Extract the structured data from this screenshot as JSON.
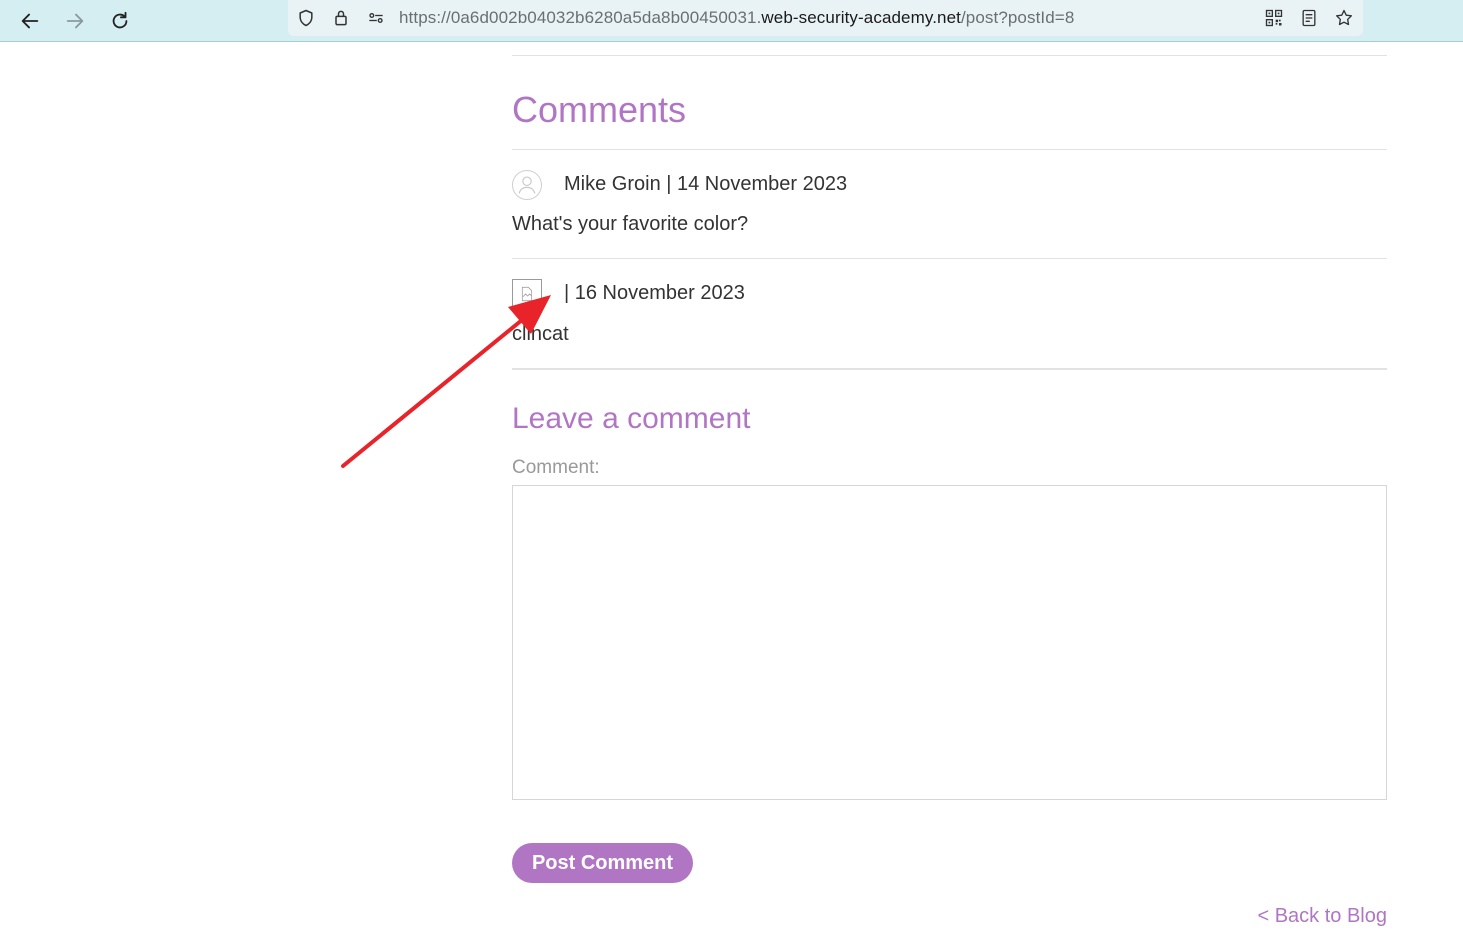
{
  "browser": {
    "url_prefix": "https://0a6d002b04032b6280a5da8b00450031.",
    "url_host": "web-security-academy.net",
    "url_path": "/post?postId=8"
  },
  "comments_heading": "Comments",
  "comments": [
    {
      "meta": "Mike Groin | 14 November 2023",
      "text": "What's your favorite color?",
      "avatar": "user-avatar"
    },
    {
      "meta": "| 16 November 2023",
      "text": "clincat",
      "avatar": "broken-image"
    }
  ],
  "form": {
    "heading": "Leave a comment",
    "comment_label": "Comment:",
    "comment_value": "",
    "submit_label": "Post Comment"
  },
  "back_link": "< Back to Blog",
  "colors": {
    "accent": "#b076c4",
    "toolbar": "#d4eef2",
    "annotation": "#e8232a"
  }
}
